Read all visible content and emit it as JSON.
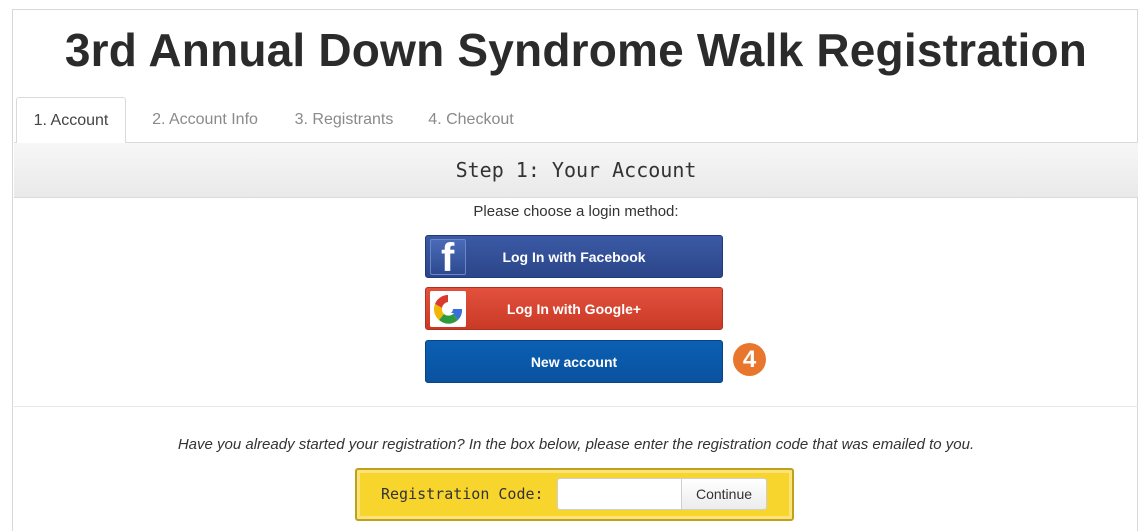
{
  "page": {
    "title": "3rd Annual Down Syndrome Walk Registration"
  },
  "tabs": [
    {
      "label": "1. Account",
      "active": true
    },
    {
      "label": "2. Account Info",
      "active": false
    },
    {
      "label": "3. Registrants",
      "active": false
    },
    {
      "label": "4. Checkout",
      "active": false
    }
  ],
  "step": {
    "heading": "Step 1: Your Account",
    "prompt": "Please choose a login method:"
  },
  "login": {
    "facebook_label": "Log In with Facebook",
    "facebook_icon": "facebook-icon",
    "facebook_glyph": "f",
    "google_label": "Log In with Google+",
    "google_icon": "google-plus-icon",
    "new_account_label": "New account"
  },
  "callout": {
    "number": "4",
    "color": "#e8762d"
  },
  "registration": {
    "note": "Have you already started your registration? In the box below, please enter the registration code that was emailed to you.",
    "code_label": "Registration Code:",
    "code_value": "",
    "continue_label": "Continue"
  },
  "colors": {
    "facebook": "#2b4589",
    "google": "#d2412d",
    "new_account": "#0a57a8",
    "code_box": "#f8d52c"
  }
}
